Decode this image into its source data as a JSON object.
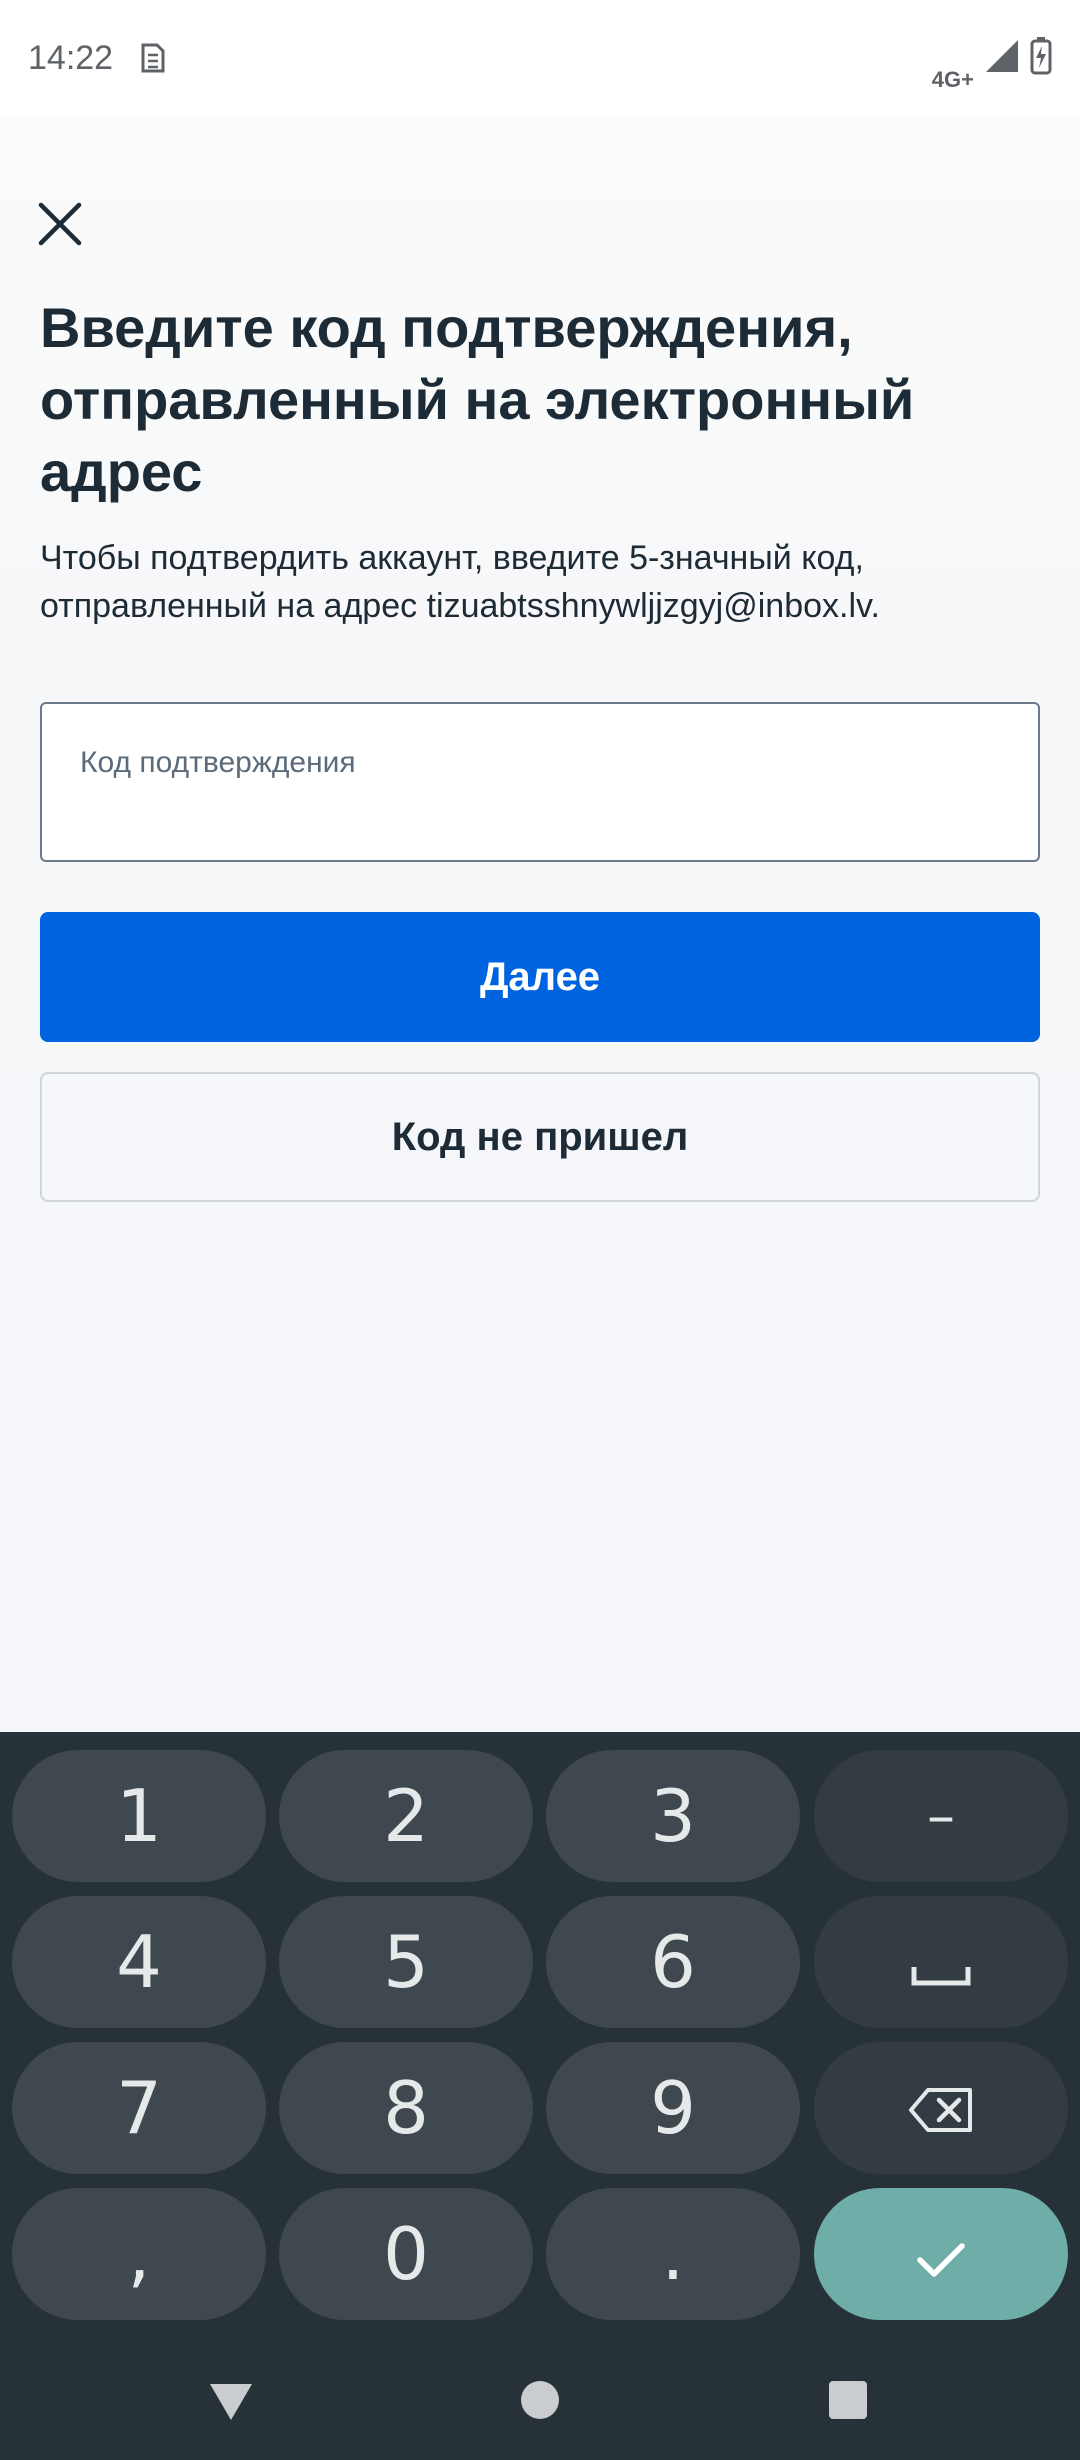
{
  "status_bar": {
    "time": "14:22",
    "network": "4G+",
    "icons": [
      "sim-card-icon",
      "signal-icon",
      "battery-charging-icon"
    ]
  },
  "header": {
    "close_icon": "close-icon"
  },
  "main": {
    "title": "Введите код подтверждения, отправленный на электронный адрес",
    "subtitle": "Чтобы подтвердить аккаунт, введите 5-значный код, отправленный на адрес tizuabtsshnywljjzgyj@inbox.lv.",
    "code_input": {
      "placeholder": "Код подтверждения",
      "value": ""
    },
    "next_button": "Далее",
    "resend_button": "Код не пришел"
  },
  "keyboard": {
    "keys": {
      "k1": "1",
      "k2": "2",
      "k3": "3",
      "minus": "–",
      "k4": "4",
      "k5": "5",
      "k6": "6",
      "k7": "7",
      "k8": "8",
      "k9": "9",
      "comma": ",",
      "k0": "0",
      "period": "."
    },
    "special_keys": [
      "space-icon",
      "backspace-icon",
      "check-icon"
    ]
  },
  "nav_bar": {
    "icons": [
      "back-triangle-icon",
      "home-circle-icon",
      "recents-square-icon"
    ]
  },
  "colors": {
    "primary_button": "#0064e0",
    "keyboard_bg": "#263238",
    "key_bg": "#3f484f",
    "enter_key": "#6fada8",
    "text_dark": "#1c2b36"
  }
}
